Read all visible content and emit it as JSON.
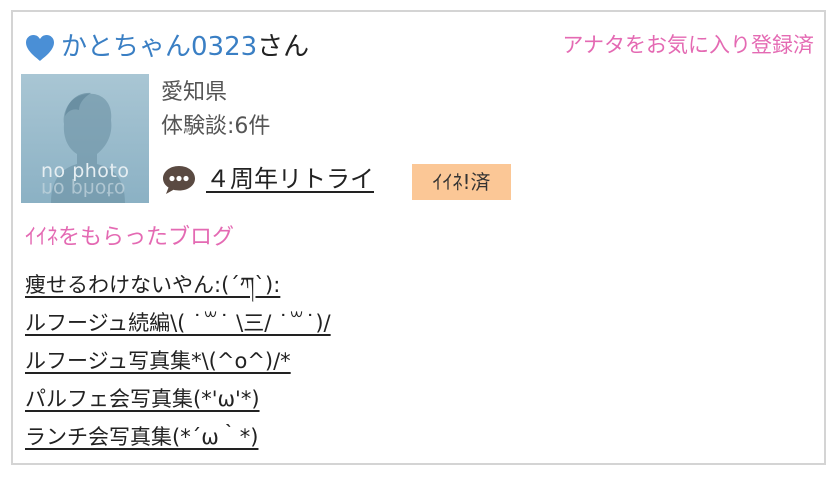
{
  "header": {
    "heart_icon": "heart-icon",
    "username": "かとちゃん0323",
    "username_suffix": "さん",
    "favorite_status": "アナタをお気に入り登録済"
  },
  "profile": {
    "avatar_placeholder": "no photo",
    "prefecture": "愛知県",
    "experience_count": "体験談:6件"
  },
  "latest_post": {
    "icon": "chat-bubble-icon",
    "title": "４周年リトライ",
    "like_badge": "ｲｲﾈ!済"
  },
  "liked_blogs": {
    "heading": "ｲｲﾈをもらったブログ",
    "items": [
      {
        "title": "痩せるわけないやん:(´ཀ`):"
      },
      {
        "title": "ルフージュ続編\\( ˙꒳˙ \\三/ ˙꒳˙)/"
      },
      {
        "title": "ルフージュ写真集*\\(^o^)/*"
      },
      {
        "title": "パルフェ会写真集(*'ω'*)"
      },
      {
        "title": "ランチ会写真集(*´ω｀*)"
      }
    ]
  },
  "colors": {
    "accent_pink": "#e46ab3",
    "username_blue": "#3a7fc4",
    "badge_orange": "#fbc796",
    "border_gray": "#d4d4d4"
  }
}
